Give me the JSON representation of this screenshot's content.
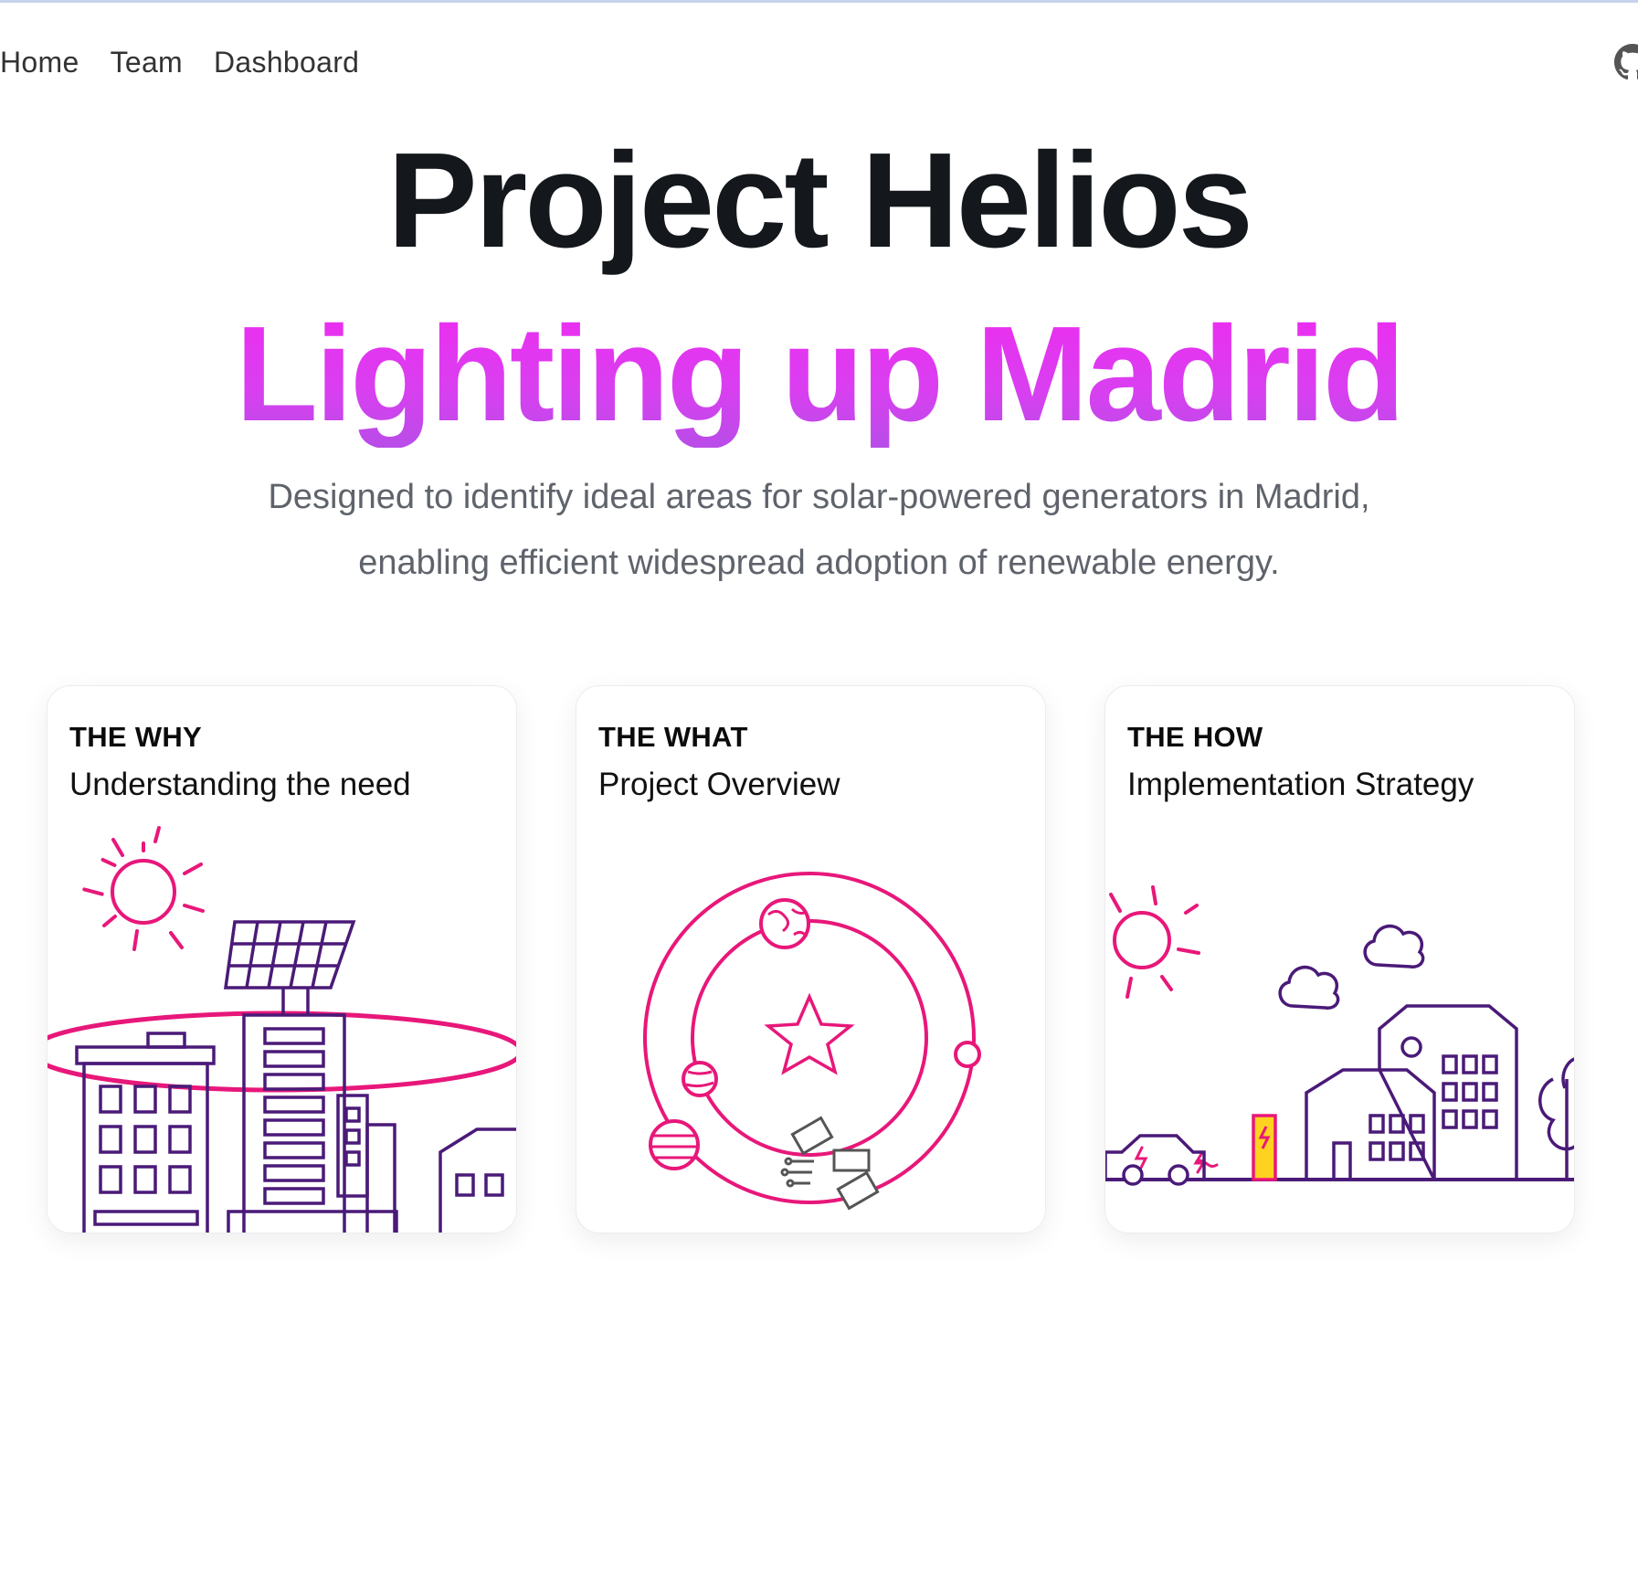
{
  "nav": {
    "items": [
      {
        "label": "Home"
      },
      {
        "label": "Team"
      },
      {
        "label": "Dashboard"
      }
    ],
    "github_icon": "github-icon"
  },
  "hero": {
    "title": "Project Helios",
    "subtitle": "Lighting up Madrid",
    "description_line1": "Designed to identify ideal areas for solar-powered generators in Madrid,",
    "description_line2": "enabling efficient widespread adoption of renewable energy."
  },
  "cards": [
    {
      "kicker": "THE WHY",
      "heading": "Understanding the need",
      "illustration": "city-solar-illustration"
    },
    {
      "kicker": "THE WHAT",
      "heading": "Project Overview",
      "illustration": "orbit-satellite-illustration"
    },
    {
      "kicker": "THE HOW",
      "heading": "Implementation Strategy",
      "illustration": "town-ev-charging-illustration"
    }
  ],
  "colors": {
    "accent_pink": "#e8177a",
    "accent_purple": "#4a1a78",
    "gradient_start": "#ee2bf0",
    "gradient_end": "#b84de8",
    "charger_yellow": "#ffd21f"
  }
}
